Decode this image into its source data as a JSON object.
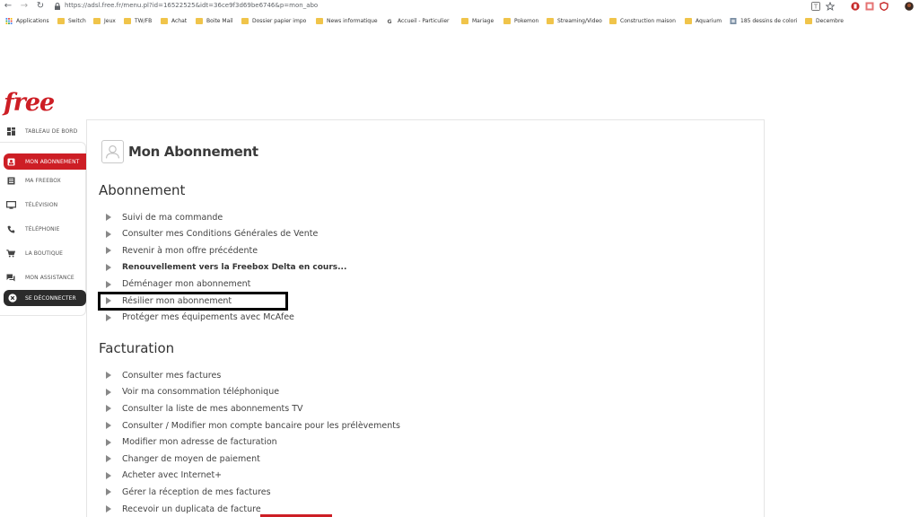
{
  "browser": {
    "url": "https://adsl.free.fr/menu.pl?id=16522525&idt=36ce9f3d69be6746&p=mon_abo",
    "bookmarks": [
      {
        "label": "Applications",
        "type": "apps"
      },
      {
        "label": "Switch",
        "type": "folder"
      },
      {
        "label": "Jeux",
        "type": "folder"
      },
      {
        "label": "TW/FB",
        "type": "folder"
      },
      {
        "label": "Achat",
        "type": "folder"
      },
      {
        "label": "Boite Mail",
        "type": "folder"
      },
      {
        "label": "Dossier papier impo",
        "type": "folder"
      },
      {
        "label": "News informatique",
        "type": "folder"
      },
      {
        "label": "Accueil - Particulier",
        "type": "site"
      },
      {
        "label": "Mariage",
        "type": "folder"
      },
      {
        "label": "Pokemon",
        "type": "folder"
      },
      {
        "label": "Streaming/Video",
        "type": "folder"
      },
      {
        "label": "Construction maison",
        "type": "folder"
      },
      {
        "label": "Aquarium",
        "type": "folder"
      },
      {
        "label": "185 dessins de colori",
        "type": "site"
      },
      {
        "label": "Decembre",
        "type": "folder"
      }
    ]
  },
  "logo": "free",
  "sidebar": {
    "items": [
      {
        "label": "TABLEAU DE BORD",
        "icon": "dashboard-icon"
      },
      {
        "label": "MON ABONNEMENT",
        "icon": "subscription-icon",
        "active": true
      },
      {
        "label": "MA FREEBOX",
        "icon": "freebox-icon"
      },
      {
        "label": "TÉLÉVISION",
        "icon": "tv-icon"
      },
      {
        "label": "TÉLÉPHONIE",
        "icon": "phone-icon"
      },
      {
        "label": "LA BOUTIQUE",
        "icon": "cart-icon"
      },
      {
        "label": "MON ASSISTANCE",
        "icon": "chat-icon"
      },
      {
        "label": "SE DÉCONNECTER",
        "icon": "close-icon"
      }
    ]
  },
  "main": {
    "title": "Mon Abonnement",
    "sections": [
      {
        "title": "Abonnement",
        "links": [
          {
            "label": "Suivi de ma commande"
          },
          {
            "label": "Consulter mes Conditions Générales de Vente"
          },
          {
            "label": "Revenir à mon offre précédente"
          },
          {
            "label": "Renouvellement vers la Freebox Delta en cours...",
            "bold": true
          },
          {
            "label": "Déménager mon abonnement"
          },
          {
            "label": "Résilier mon abonnement"
          },
          {
            "label": "Protéger mes équipements avec McAfee"
          }
        ]
      },
      {
        "title": "Facturation",
        "links": [
          {
            "label": "Consulter mes factures"
          },
          {
            "label": "Voir ma consommation téléphonique"
          },
          {
            "label": "Consulter la liste de mes abonnements TV"
          },
          {
            "label": "Consulter / Modifier mon compte bancaire pour les prélèvements"
          },
          {
            "label": "Modifier mon adresse de facturation"
          },
          {
            "label": "Changer de moyen de paiement"
          },
          {
            "label": "Acheter avec Internet+"
          },
          {
            "label": "Gérer la réception de mes factures"
          },
          {
            "label": "Recevoir un duplicata de facture"
          }
        ]
      }
    ]
  },
  "colors": {
    "brand": "#cd1e25",
    "logout_bg": "#2b2b2b",
    "highlight_border": "#000000"
  }
}
